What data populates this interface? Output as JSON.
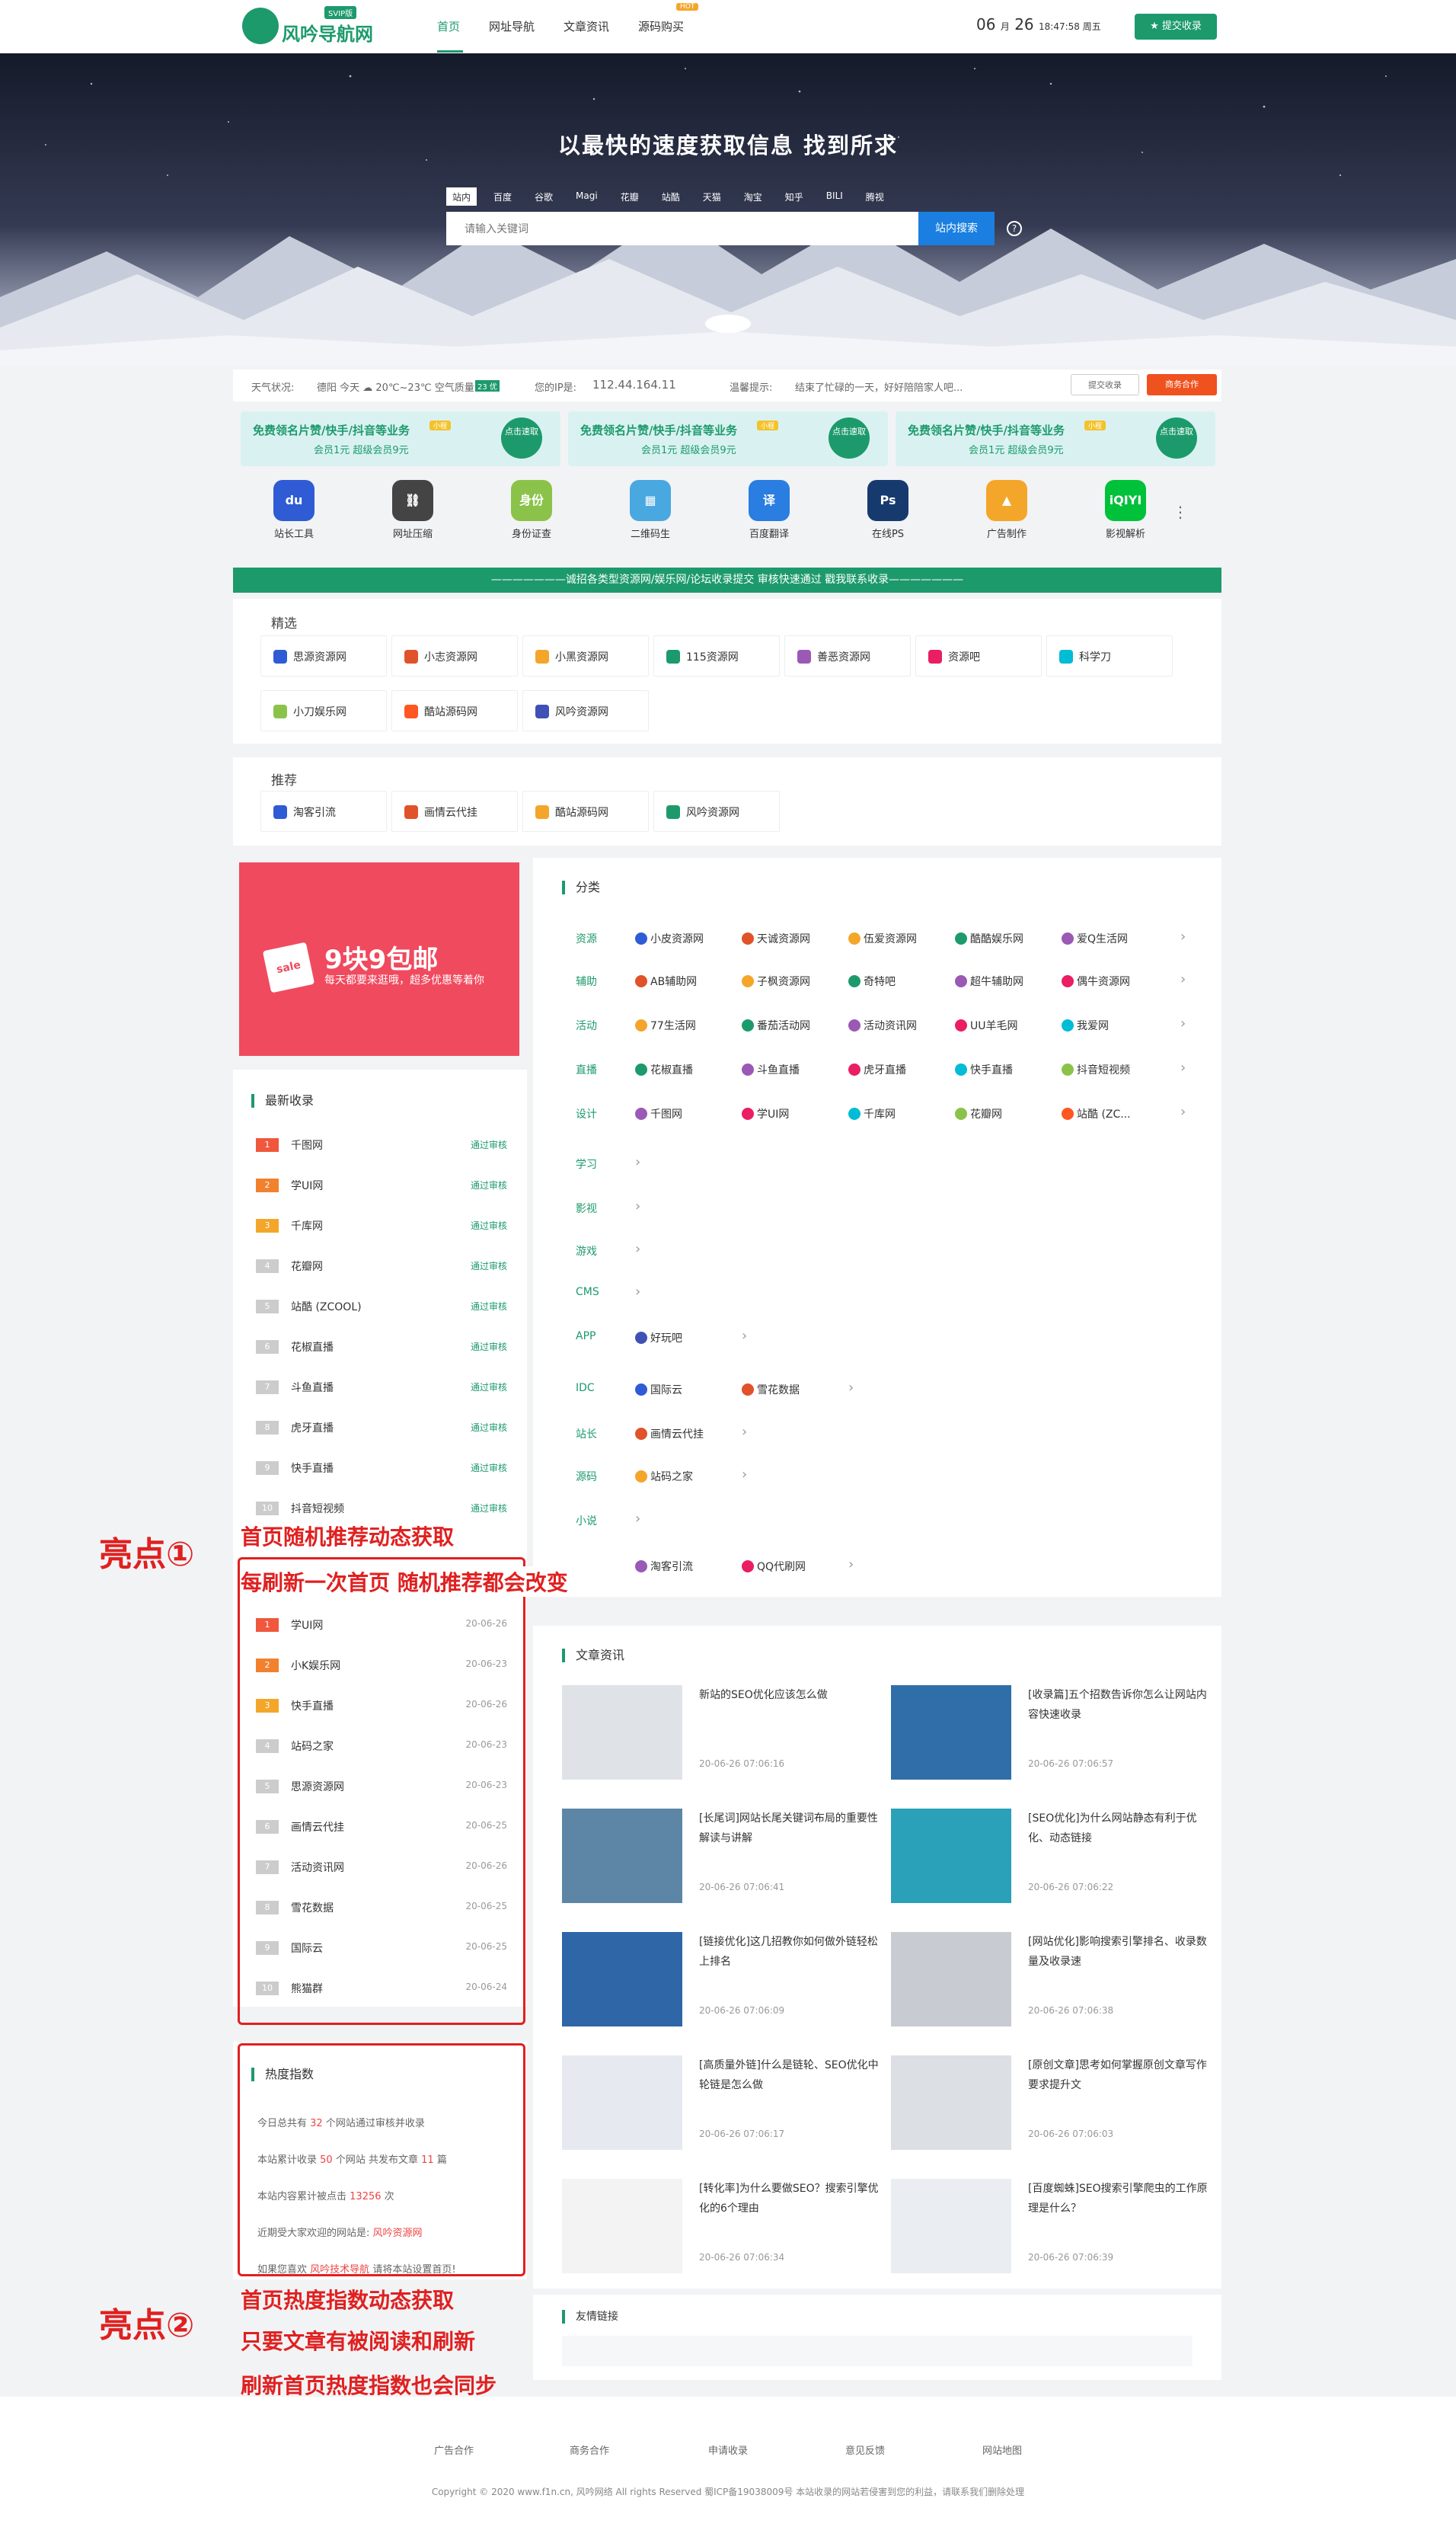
{
  "header": {
    "brand": "风吟导航网",
    "brand_badge": "SVIP版",
    "nav": [
      "首页",
      "网址导航",
      "文章资讯",
      "源码购买"
    ],
    "nav_hot": "HOT",
    "date_month": "06",
    "date_month_unit": "月",
    "date_day": "26",
    "date_time": "18:47:58 周五",
    "submit": "提交收录"
  },
  "hero": {
    "title": "以最快的速度获取信息 找到所求",
    "tabs": [
      "站内",
      "百度",
      "谷歌",
      "Magi",
      "花瓣",
      "站酷",
      "天猫",
      "淘宝",
      "知乎",
      "BILI",
      "腾视"
    ],
    "placeholder": "请输入关键词",
    "search_btn": "站内搜索",
    "help": "?"
  },
  "infobar": {
    "weather_label": "天气状况:",
    "weather": "德阳 今天 ☁ 20℃~23℃ 空气质量:",
    "aq": "23 优",
    "ip_label": "您的IP是:",
    "ip": "112.44.164.11",
    "tip_label": "温馨提示:",
    "tip": "结束了忙碌的一天，好好陪陪家人吧...",
    "btn_submit": "提交收录",
    "btn_biz": "商务合作"
  },
  "banners": [
    {
      "title": "免费领名片赞/快手/抖音等业务",
      "badge": "小程",
      "sub": "会员1元 超级会员9元",
      "circle": "点击速取"
    },
    {
      "title": "免费领名片赞/快手/抖音等业务",
      "badge": "小程",
      "sub": "会员1元 超级会员9元",
      "circle": "点击速取"
    },
    {
      "title": "免费领名片赞/快手/抖音等业务",
      "badge": "小程",
      "sub": "会员1元 超级会员9元",
      "circle": "点击速取"
    }
  ],
  "tools": [
    {
      "label": "站长工具",
      "glyph": "du",
      "color": "#2f5bd5"
    },
    {
      "label": "网址压缩",
      "glyph": "⛓",
      "color": "#444"
    },
    {
      "label": "身份证查",
      "glyph": "身份",
      "color": "#8bc34a"
    },
    {
      "label": "二维码生",
      "glyph": "▦",
      "color": "#4aa8e0"
    },
    {
      "label": "百度翻译",
      "glyph": "译",
      "color": "#2a7de1"
    },
    {
      "label": "在线PS",
      "glyph": "Ps",
      "color": "#173a6e"
    },
    {
      "label": "广告制作",
      "glyph": "▲",
      "color": "#f4a62a"
    },
    {
      "label": "影视解析",
      "glyph": "iQIYI",
      "color": "#00c13a"
    }
  ],
  "notice": "———————诚招各类型资源网/娱乐网/论坛收录提交 审核快速通过 戳我联系收录———————",
  "jingxuan": {
    "title": "精选",
    "items": [
      "思源资源网",
      "小志资源网",
      "小黑资源网",
      "115资源网",
      "善恶资源网",
      "资源吧",
      "科学刀",
      "小刀娱乐网",
      "酷站源码网",
      "风吟资源网"
    ]
  },
  "tuijian": {
    "title": "推荐",
    "items": [
      "淘客引流",
      "画情云代挂",
      "酷站源码网",
      "风吟资源网"
    ]
  },
  "sale": {
    "title": "9块9包邮",
    "sub": "每天都要来逛哦，超多优惠等着你",
    "bag": "sale"
  },
  "latest": {
    "title": "最新收录",
    "status": "通过审核",
    "items": [
      "千图网",
      "学UI网",
      "千库网",
      "花瓣网",
      "站酷 (ZCOOL)",
      "花椒直播",
      "斗鱼直播",
      "虎牙直播",
      "快手直播",
      "抖音短视频"
    ]
  },
  "random": {
    "items": [
      {
        "name": "学UI网",
        "date": "20-06-26"
      },
      {
        "name": "小K娱乐网",
        "date": "20-06-23"
      },
      {
        "name": "快手直播",
        "date": "20-06-26"
      },
      {
        "name": "站码之家",
        "date": "20-06-23"
      },
      {
        "name": "思源资源网",
        "date": "20-06-23"
      },
      {
        "name": "画情云代挂",
        "date": "20-06-25"
      },
      {
        "name": "活动资讯网",
        "date": "20-06-26"
      },
      {
        "name": "雪花数据",
        "date": "20-06-25"
      },
      {
        "name": "国际云",
        "date": "20-06-25"
      },
      {
        "name": "熊猫群",
        "date": "20-06-24"
      }
    ]
  },
  "heat": {
    "title": "热度指数",
    "l1a": "今日总共有",
    "l1n": "32",
    "l1b": "个网站通过审核并收录",
    "l2a": "本站累计收录",
    "l2n": "50",
    "l2b": "个网站 共发布文章",
    "l2n2": "11",
    "l2c": "篇",
    "l3a": "本站内容累计被点击",
    "l3n": "13256",
    "l3b": "次",
    "l4a": "近期受大家欢迎的网站是:",
    "l4n": "风吟资源网",
    "l5a": "如果您喜欢",
    "l5n": "风吟技术导航",
    "l5b": "请将本站设置首页!"
  },
  "category": {
    "title": "分类",
    "rows": [
      {
        "name": "资源",
        "sites": [
          "小皮资源网",
          "天诚资源网",
          "伍爱资源网",
          "酷酷娱乐网",
          "爱Q生活网"
        ]
      },
      {
        "name": "辅助",
        "sites": [
          "AB辅助网",
          "子枫资源网",
          "奇特吧",
          "超牛辅助网",
          "偶牛资源网"
        ]
      },
      {
        "name": "活动",
        "sites": [
          "77生活网",
          "番茄活动网",
          "活动资讯网",
          "UU羊毛网",
          "我爱网"
        ]
      },
      {
        "name": "直播",
        "sites": [
          "花椒直播",
          "斗鱼直播",
          "虎牙直播",
          "快手直播",
          "抖音短视频"
        ]
      },
      {
        "name": "设计",
        "sites": [
          "千图网",
          "学UI网",
          "千库网",
          "花瓣网",
          "站酷 (ZC..."
        ]
      },
      {
        "name": "学习",
        "sites": []
      },
      {
        "name": "影视",
        "sites": []
      },
      {
        "name": "游戏",
        "sites": []
      },
      {
        "name": "CMS",
        "sites": []
      },
      {
        "name": "APP",
        "sites": [
          "好玩吧"
        ]
      },
      {
        "name": "IDC",
        "sites": [
          "国际云",
          "雪花数据"
        ]
      },
      {
        "name": "站长",
        "sites": [
          "画情云代挂"
        ]
      },
      {
        "name": "源码",
        "sites": [
          "站码之家"
        ]
      },
      {
        "name": "小说",
        "sites": []
      },
      {
        "name": "",
        "sites": [
          "淘客引流",
          "QQ代刷网"
        ]
      }
    ]
  },
  "articles": {
    "title": "文章资讯",
    "items": [
      {
        "title": "新站的SEO优化应该怎么做",
        "date": "20-06-26 07:06:16"
      },
      {
        "title": "[收录篇]五个招数告诉你怎么让网站内容快速收录",
        "date": "20-06-26 07:06:57"
      },
      {
        "title": "[长尾词]网站长尾关键词布局的重要性解读与讲解",
        "date": "20-06-26 07:06:41"
      },
      {
        "title": "[SEO优化]为什么网站静态有利于优化、动态链接",
        "date": "20-06-26 07:06:22"
      },
      {
        "title": "[链接优化]这几招教你如何做外链轻松上排名",
        "date": "20-06-26 07:06:09"
      },
      {
        "title": "[网站优化]影响搜索引擎排名、收录数量及收录速",
        "date": "20-06-26 07:06:38"
      },
      {
        "title": "[高质量外链]什么是链轮、SEO优化中轮链是怎么做",
        "date": "20-06-26 07:06:17"
      },
      {
        "title": "[原创文章]思考如何掌握原创文章写作要求提升文",
        "date": "20-06-26 07:06:03"
      },
      {
        "title": "[转化率]为什么要做SEO？搜索引擎优化的6个理由",
        "date": "20-06-26 07:06:34"
      },
      {
        "title": "[百度蜘蛛]SEO搜索引擎爬虫的工作原理是什么？",
        "date": "20-06-26 07:06:39"
      }
    ]
  },
  "friends": {
    "title": "友情链接"
  },
  "annot": {
    "a1": "亮点①",
    "a1l1": "首页随机推荐动态获取",
    "a1l2": "每刷新一次首页 随机推荐都会改变",
    "a2": "亮点②",
    "a2l1": "首页热度指数动态获取",
    "a2l2": "只要文章有被阅读和刷新",
    "a2l3": "刷新首页热度指数也会同步"
  },
  "footer": {
    "links": [
      "广告合作",
      "商务合作",
      "申请收录",
      "意见反馈",
      "网站地图"
    ],
    "copy": "Copyright © 2020 www.f1n.cn, 风吟网络 All rights Reserved  蜀ICP备19038009号  本站收录的网站若侵害到您的利益，请联系我们删除处理"
  }
}
